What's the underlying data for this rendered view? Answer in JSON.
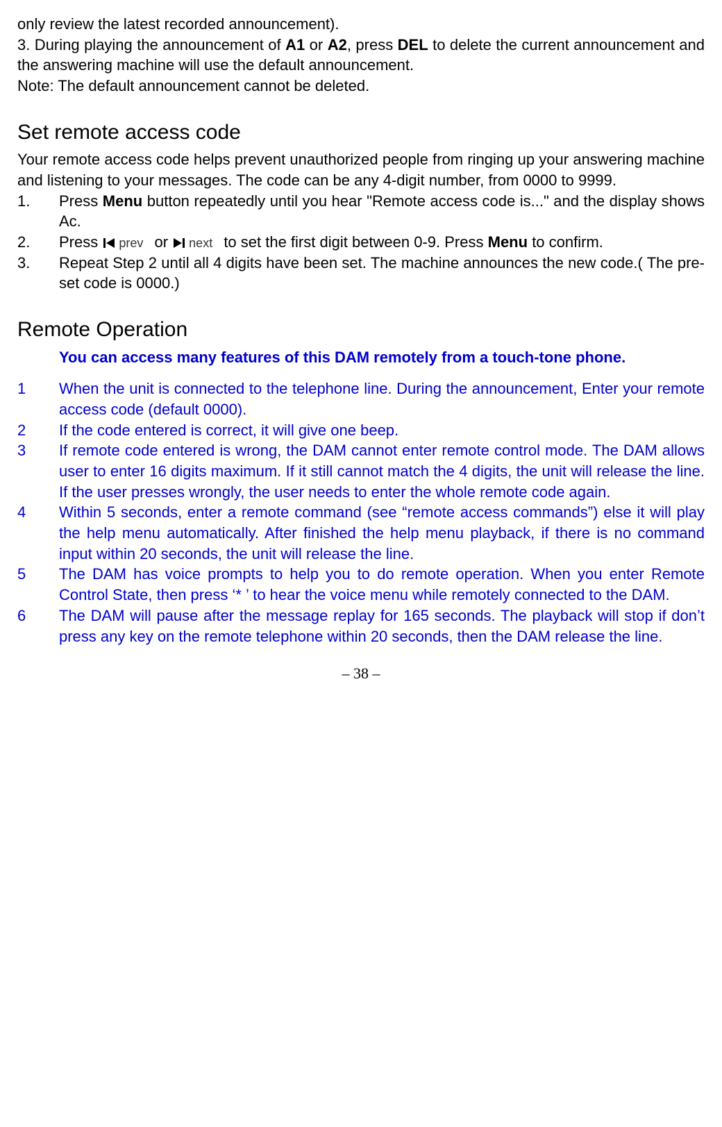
{
  "intro": {
    "line1": "only review the latest recorded announcement).",
    "line2_pt1": "3. During playing the announcement of ",
    "line2_a1": "A1",
    "line2_or": " or ",
    "line2_a2": "A2",
    "line2_pt2": ", press ",
    "line2_del": "DEL",
    "line2_pt3": " to delete the current announcement and the answering machine will use the default announcement.",
    "note": "Note: The default announcement cannot be deleted."
  },
  "section1": {
    "heading": "Set remote access code",
    "intro": "Your remote access code helps prevent unauthorized people from ringing up your answering machine and listening to your messages. The code can be any 4-digit number, from 0000 to 9999.",
    "items": [
      {
        "num": "1.",
        "pt1": "Press ",
        "bold1": "Menu",
        "pt2": " button repeatedly until you hear \"Remote access code is...\" and the display shows Ac."
      },
      {
        "num": "2.",
        "pt1": "Press ",
        "prev_label": "prev",
        "or": " or ",
        "next_label": "next",
        "pt2": " to set the first digit between 0-9. Press ",
        "bold1": "Menu",
        "pt3": " to confirm."
      },
      {
        "num": "3.",
        "text": "Repeat Step 2 until all 4 digits have been set. The machine announces the new code.( The pre-set code is 0000.)"
      }
    ]
  },
  "section2": {
    "heading": "Remote Operation",
    "lead": "You can access many features of this DAM remotely from a touch-tone phone.",
    "items": [
      {
        "num": "1",
        "text": "When the unit is connected to the telephone line. During the announcement, Enter your remote access code (default 0000)."
      },
      {
        "num": "2",
        "text": "If the code entered is correct, it will give one beep."
      },
      {
        "num": "3",
        "text": "If remote code entered is wrong, the DAM cannot enter remote control mode. The DAM allows user to enter 16 digits maximum. If it still cannot match the 4 digits, the unit will release the line. If the user presses wrongly, the user needs to enter the whole remote code again."
      },
      {
        "num": "4",
        "text": "Within 5 seconds, enter a remote command (see “remote access commands”) else it will play the help menu automatically. After finished the help menu playback, if there is no command input within 20 seconds, the unit will release the line."
      },
      {
        "num": "5",
        "text": "The DAM has voice prompts to help you to do remote operation. When you enter Remote Control State, then press ‘* ’ to hear the voice menu while remotely connected to the DAM."
      },
      {
        "num": "6",
        "text": "The DAM will pause after the message replay for 165 seconds. The playback will stop if don’t press any key on the remote telephone within 20 seconds, then the DAM release the line."
      }
    ]
  },
  "page_num": "– 38 –"
}
